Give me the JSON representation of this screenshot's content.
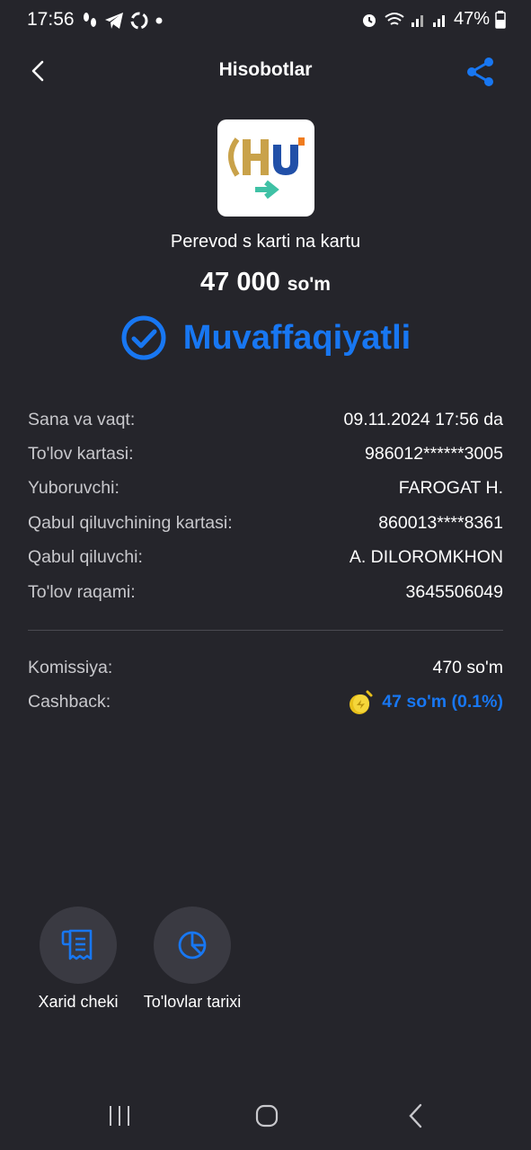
{
  "status_bar": {
    "time": "17:56",
    "battery": "47%"
  },
  "header": {
    "title": "Hisobotlar"
  },
  "transaction": {
    "service_name": "Perevod s karti na kartu",
    "amount": "47 000",
    "currency": "so'm",
    "status": "Muvaffaqiyatli"
  },
  "details": [
    {
      "label": "Sana va vaqt:",
      "value": "09.11.2024 17:56 da"
    },
    {
      "label": "To'lov kartasi:",
      "value": "986012******3005"
    },
    {
      "label": "Yuboruvchi:",
      "value": "FAROGAT H."
    },
    {
      "label": "Qabul qiluvchining kartasi:",
      "value": "860013****8361"
    },
    {
      "label": "Qabul qiluvchi:",
      "value": "A. DILOROMKHON"
    },
    {
      "label": "To'lov raqami:",
      "value": "3645506049"
    }
  ],
  "fees": {
    "commission_label": "Komissiya:",
    "commission_value": "470 so'm",
    "cashback_label": "Cashback:",
    "cashback_value": "47 so'm (0.1%)"
  },
  "actions": {
    "receipt_label": "Xarid cheki",
    "history_label": "To'lovlar tarixi"
  },
  "colors": {
    "background": "#25252b",
    "accent": "#1877f2",
    "action_bg": "#3a3a42",
    "logo_teal": "#3fc1a5",
    "logo_gold": "#c9a24a"
  },
  "icons": {
    "back": "chevron-left-icon",
    "share": "share-icon",
    "status": "check-circle-icon",
    "cashback": "coin-icon",
    "receipt": "receipt-icon",
    "history": "pie-chart-icon"
  }
}
